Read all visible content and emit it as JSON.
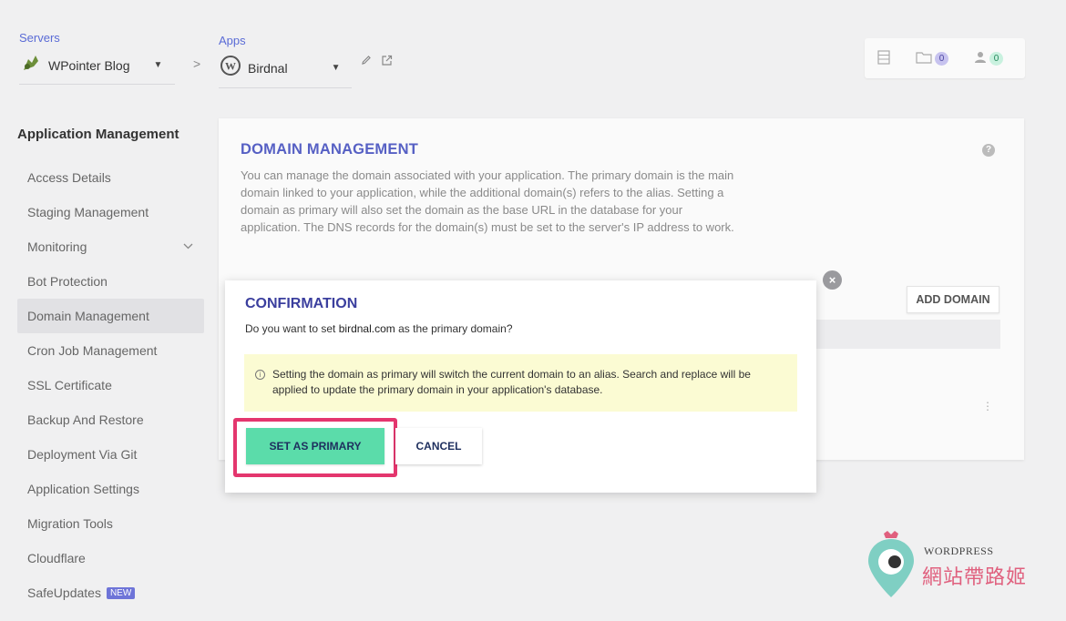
{
  "header": {
    "servers_label": "Servers",
    "server_name": "WPointer Blog",
    "separator": ">",
    "apps_label": "Apps",
    "app_name": "Birdnal",
    "caret": "▼",
    "toolbar": {
      "files_count": "0",
      "users_count": "0"
    }
  },
  "sidebar": {
    "title": "Application Management",
    "items": [
      {
        "label": "Access Details"
      },
      {
        "label": "Staging Management"
      },
      {
        "label": "Monitoring"
      },
      {
        "label": "Bot Protection"
      },
      {
        "label": "Domain Management"
      },
      {
        "label": "Cron Job Management"
      },
      {
        "label": "SSL Certificate"
      },
      {
        "label": "Backup And Restore"
      },
      {
        "label": "Deployment Via Git"
      },
      {
        "label": "Application Settings"
      },
      {
        "label": "Migration Tools"
      },
      {
        "label": "Cloudflare"
      },
      {
        "label": "SafeUpdates",
        "badge": "NEW"
      }
    ]
  },
  "main": {
    "title": "DOMAIN MANAGEMENT",
    "description": "You can manage the domain associated with your application. The primary domain is the main domain linked to your application, while the additional domain(s) refers to the alias. Setting a domain as primary will also set the domain as the base URL in the database for your application. The DNS records for the domain(s) must be set to the server's IP address to work.",
    "help": "?",
    "add_domain_label": "ADD DOMAIN",
    "kebab": "⋮"
  },
  "dialog": {
    "title": "CONFIRMATION",
    "question_prefix": "Do you want to set ",
    "domain": "birdnal.com",
    "question_suffix": " as the primary domain?",
    "notice_icon": "i",
    "notice": "Setting the domain as primary will switch the current domain to an alias. Search and replace will be applied to update the primary domain in your application's database.",
    "primary_button": "SET AS PRIMARY",
    "cancel_button": "CANCEL",
    "close": "×"
  },
  "watermark": {
    "line1": "WORDPRESS",
    "line2": "網站帶路姬"
  },
  "colors": {
    "accent": "#5660c4",
    "primary_button": "#5bdcaa",
    "highlight": "#e4366e",
    "notice_bg": "#fbfbd3"
  }
}
